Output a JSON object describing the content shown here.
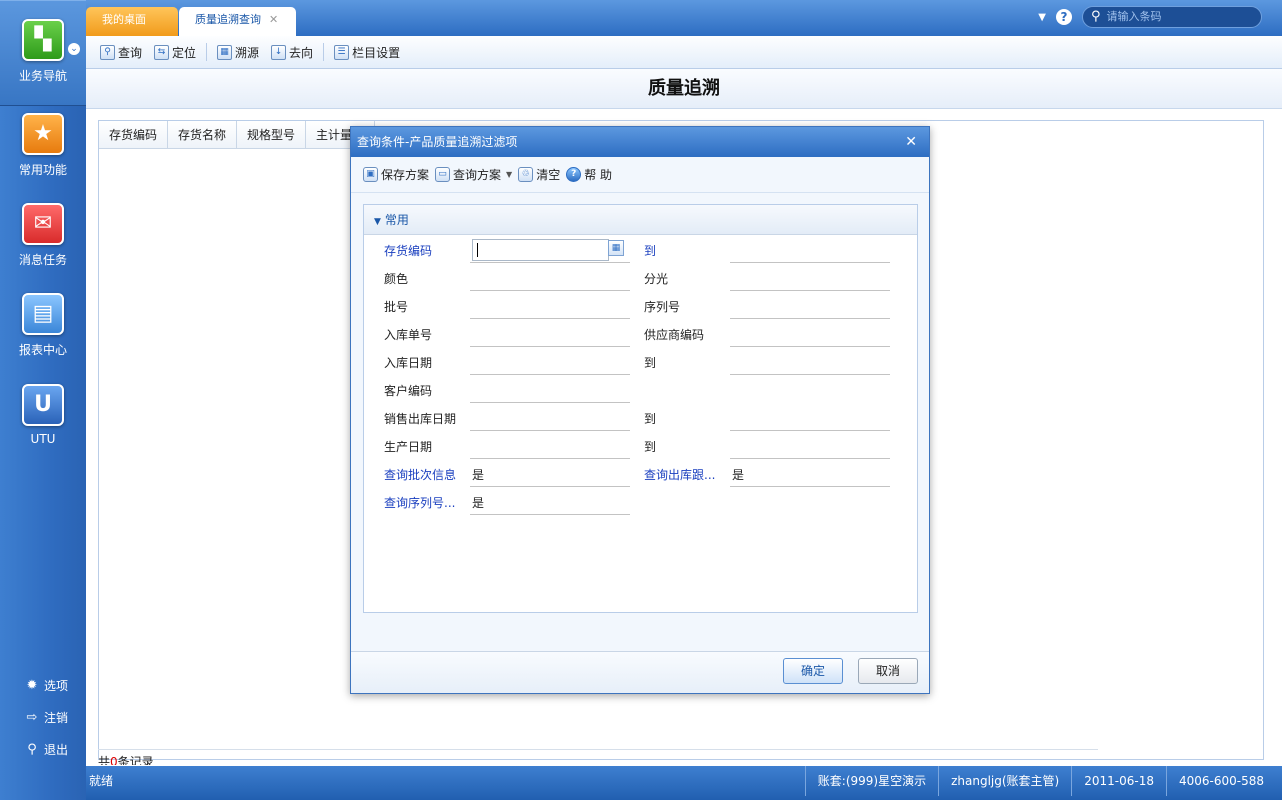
{
  "sidebar": {
    "items": [
      {
        "label": "业务导航",
        "icon": "business-nav-icon"
      },
      {
        "label": "常用功能",
        "icon": "star-icon"
      },
      {
        "label": "消息任务",
        "icon": "message-icon"
      },
      {
        "label": "报表中心",
        "icon": "report-icon"
      },
      {
        "label": "UTU",
        "icon": "utu-icon"
      }
    ],
    "bottom": [
      {
        "label": "选项",
        "icon": "gear-icon"
      },
      {
        "label": "注销",
        "icon": "logout-icon"
      },
      {
        "label": "退出",
        "icon": "key-icon"
      }
    ]
  },
  "tabs": [
    {
      "label": "我的桌面"
    },
    {
      "label": "质量追溯查询"
    }
  ],
  "topbar": {
    "search_placeholder": "请输入条码"
  },
  "toolbar": {
    "query": "查询",
    "locate": "定位",
    "trace_source": "溯源",
    "trace_dest": "去向",
    "column_settings": "栏目设置"
  },
  "main": {
    "title": "质量追溯",
    "columns": [
      "存货编码",
      "存货名称",
      "规格型号",
      "主计量单"
    ],
    "record_prefix": "共",
    "record_count": "0",
    "record_suffix": "条记录"
  },
  "dialog": {
    "title": "查询条件-产品质量追溯过滤项",
    "tools": {
      "save_scheme": "保存方案",
      "query_scheme": "查询方案",
      "clear": "清空",
      "help": "帮 助"
    },
    "section": "常用",
    "fields": [
      {
        "left": "存货编码",
        "right": "到"
      },
      {
        "left": "颜色",
        "right": "分光"
      },
      {
        "left": "批号",
        "right": "序列号"
      },
      {
        "left": "入库单号",
        "right": "供应商编码"
      },
      {
        "left": "入库日期",
        "right": "到"
      },
      {
        "left": "客户编码",
        "right": ""
      },
      {
        "left": "销售出库日期",
        "right": "到"
      },
      {
        "left": "生产日期",
        "right": "到"
      },
      {
        "left": "查询批次信息",
        "left_value": "是",
        "right": "查询出库跟...",
        "right_value": "是"
      },
      {
        "left": "查询序列号...",
        "left_value": "是",
        "right": ""
      }
    ],
    "ok": "确定",
    "cancel": "取消"
  },
  "status": {
    "left": "就绪",
    "account": "账套:(999)星空演示",
    "user": "zhangljg(账套主管)",
    "date": "2011-06-18",
    "phone": "4006-600-588"
  }
}
